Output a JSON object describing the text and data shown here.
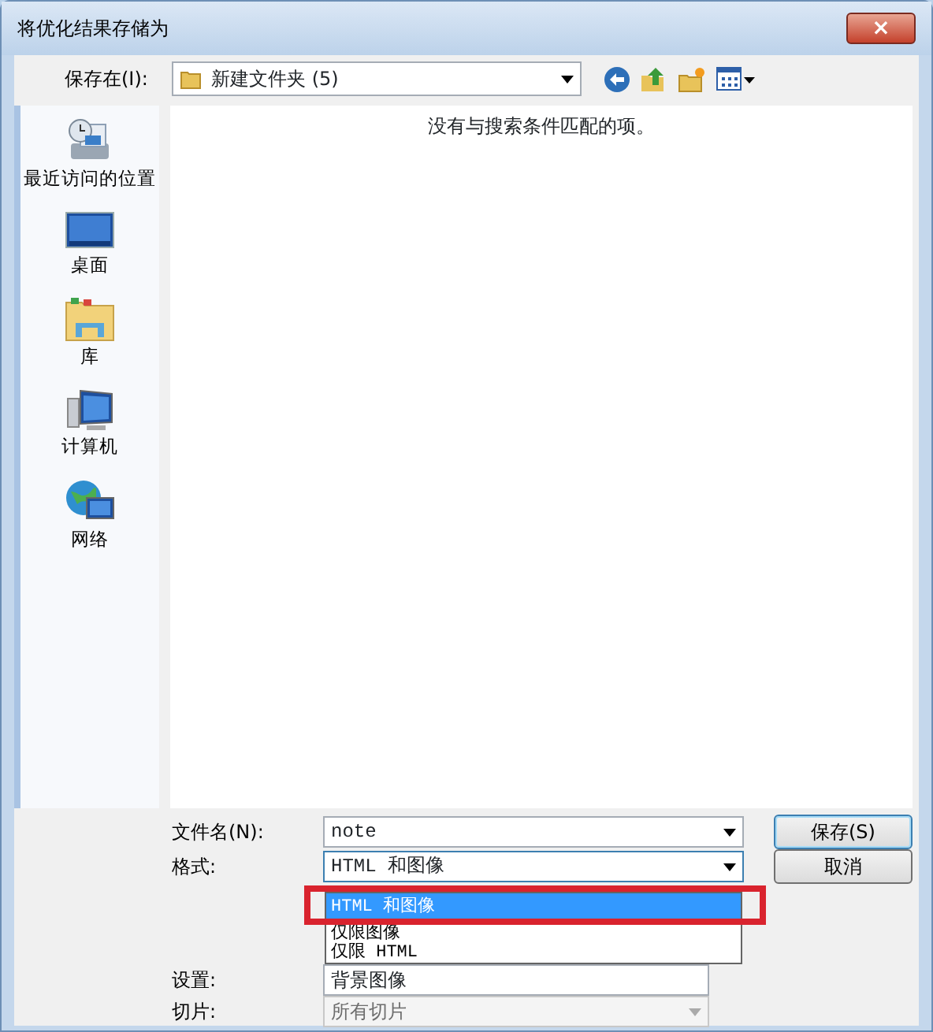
{
  "window": {
    "title": "将优化结果存储为",
    "close": "×"
  },
  "save_in": {
    "label": "保存在(I):",
    "folder": "新建文件夹 (5)"
  },
  "sidebar": {
    "items": [
      {
        "kind": "recent",
        "label": "最近访问的位置"
      },
      {
        "kind": "desktop",
        "label": "桌面"
      },
      {
        "kind": "library",
        "label": "库"
      },
      {
        "kind": "computer",
        "label": "计算机"
      },
      {
        "kind": "network",
        "label": "网络"
      }
    ]
  },
  "file_list": {
    "empty_message": "没有与搜索条件匹配的项。"
  },
  "form": {
    "file_name": {
      "label": "文件名(N):",
      "value": "note"
    },
    "format": {
      "label": "格式:",
      "value": "HTML 和图像",
      "expanded": true,
      "options": [
        {
          "label": "HTML 和图像",
          "selected": true
        },
        {
          "label": "仅限图像",
          "selected": false
        },
        {
          "label": "仅限 HTML",
          "selected": false
        }
      ]
    },
    "settings": {
      "label": "设置:",
      "value": "背景图像"
    },
    "slices": {
      "label": "切片:",
      "value": "所有切片",
      "disabled": true
    }
  },
  "buttons": [
    {
      "label": "保存(S)",
      "default": true
    },
    {
      "label": "取消",
      "default": false
    }
  ],
  "annotation": {
    "kind": "highlight",
    "color": "#d9232e"
  }
}
